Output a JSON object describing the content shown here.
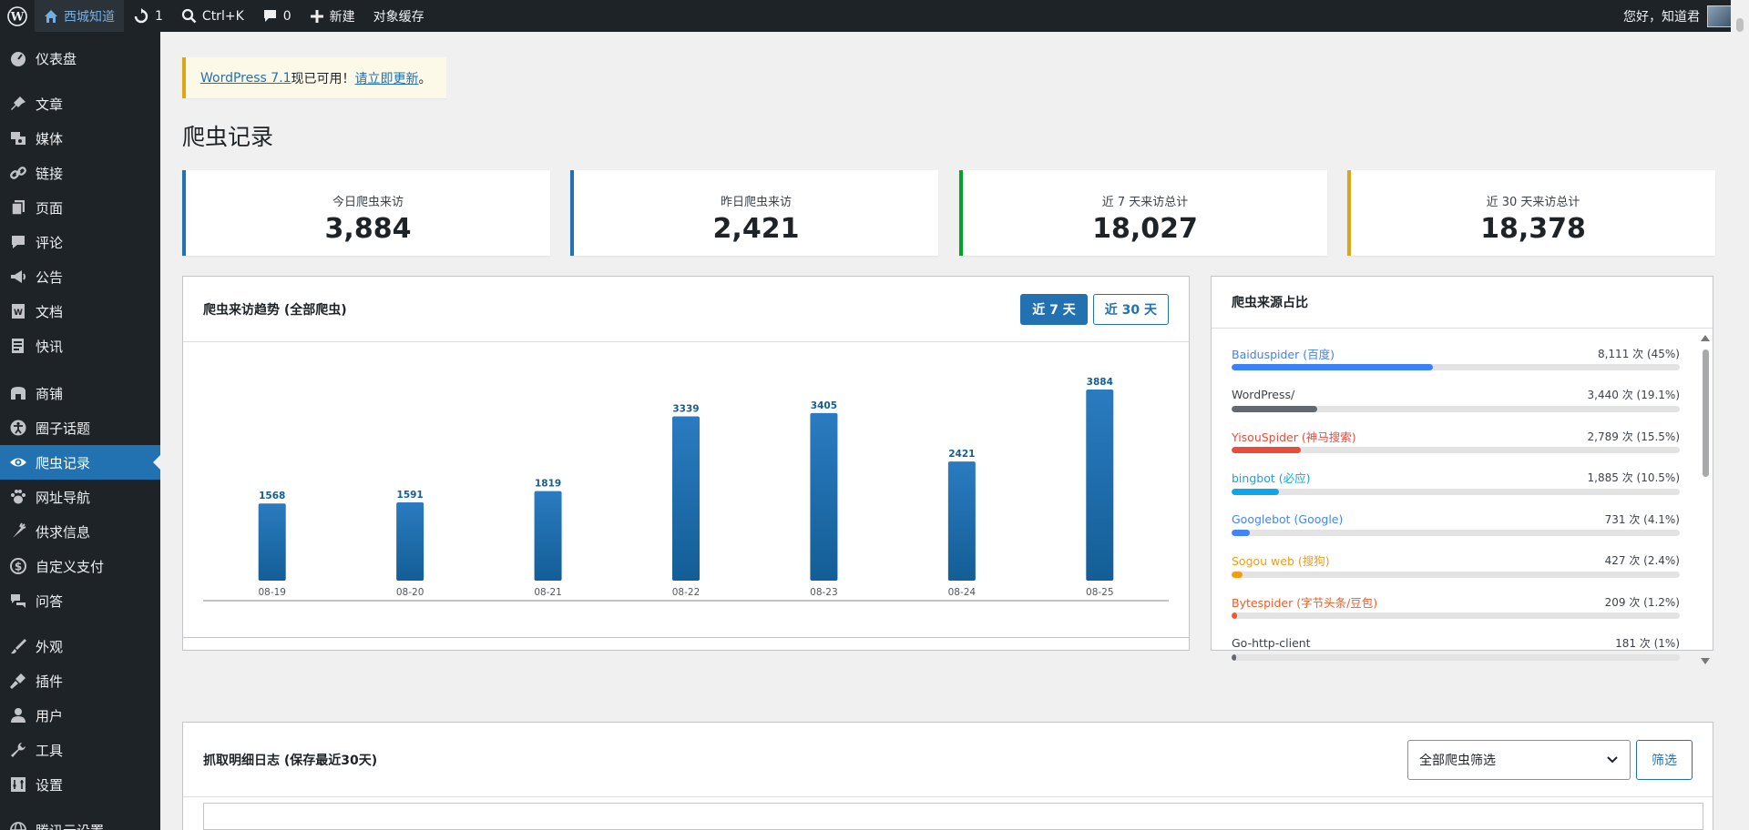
{
  "admin_bar": {
    "site_name": "西城知道",
    "updates_count": "1",
    "search_shortcut": "Ctrl+K",
    "comments_count": "0",
    "new_label": "新建",
    "object_cache_label": "对象缓存",
    "greeting": "您好，知道君"
  },
  "sidebar": {
    "items": [
      {
        "label": "仪表盘",
        "icon": "dashboard-icon"
      },
      {
        "label": "文章",
        "icon": "pin-icon"
      },
      {
        "label": "媒体",
        "icon": "media-icon"
      },
      {
        "label": "链接",
        "icon": "link-icon"
      },
      {
        "label": "页面",
        "icon": "page-icon"
      },
      {
        "label": "评论",
        "icon": "comment-icon"
      },
      {
        "label": "公告",
        "icon": "megaphone-icon"
      },
      {
        "label": "文档",
        "icon": "document-icon"
      },
      {
        "label": "快讯",
        "icon": "news-icon"
      },
      {
        "label": "商铺",
        "icon": "shop-icon"
      },
      {
        "label": "圈子话题",
        "icon": "accessibility-icon"
      },
      {
        "label": "爬虫记录",
        "icon": "eye-icon"
      },
      {
        "label": "网址导航",
        "icon": "paw-icon"
      },
      {
        "label": "供求信息",
        "icon": "carrot-icon"
      },
      {
        "label": "自定义支付",
        "icon": "dollar-icon"
      },
      {
        "label": "问答",
        "icon": "chat-icon"
      },
      {
        "label": "外观",
        "icon": "brush-icon"
      },
      {
        "label": "插件",
        "icon": "plugin-icon"
      },
      {
        "label": "用户",
        "icon": "user-icon"
      },
      {
        "label": "工具",
        "icon": "wrench-icon"
      },
      {
        "label": "设置",
        "icon": "settings-icon"
      },
      {
        "label": "腾讯云设置",
        "icon": "globe-icon"
      }
    ]
  },
  "notice": {
    "link_text": "WordPress 7.1",
    "middle_text": " 现已可用！",
    "action_text": "请立即更新",
    "end_text": "。"
  },
  "page_title": "爬虫记录",
  "stats": [
    {
      "label": "今日爬虫来访",
      "value": "3,884",
      "color": "#2271b1"
    },
    {
      "label": "昨日爬虫来访",
      "value": "2,421",
      "color": "#2271b1"
    },
    {
      "label": "近 7 天来访总计",
      "value": "18,027",
      "color": "#00a32a"
    },
    {
      "label": "近 30 天来访总计",
      "value": "18,378",
      "color": "#dba617"
    }
  ],
  "trend": {
    "title": "爬虫来访趋势 (全部爬虫)",
    "btn_7": "近 7 天",
    "btn_30": "近 30 天"
  },
  "chart_data": {
    "type": "bar",
    "categories": [
      "08-19",
      "08-20",
      "08-21",
      "08-22",
      "08-23",
      "08-24",
      "08-25"
    ],
    "values": [
      1568,
      1591,
      1819,
      3339,
      3405,
      2421,
      3884
    ],
    "title": "",
    "xlabel": "",
    "ylabel": "",
    "ylim": [
      0,
      3884
    ],
    "color": "#2271b1",
    "grid": false
  },
  "sources": {
    "title": "爬虫来源占比",
    "items": [
      {
        "name": "Baiduspider (百度)",
        "count": "8,111 次 (45%)",
        "pct": 45,
        "color": "#3b82f6"
      },
      {
        "name": "WordPress/",
        "count": "3,440 次 (19.1%)",
        "pct": 19.1,
        "color": "#646970"
      },
      {
        "name": "YisouSpider (神马搜索)",
        "count": "2,789 次 (15.5%)",
        "pct": 15.5,
        "color": "#e74c3c"
      },
      {
        "name": "bingbot (必应)",
        "count": "1,885 次 (10.5%)",
        "pct": 10.5,
        "color": "#0ea5e9"
      },
      {
        "name": "Googlebot (Google)",
        "count": "731 次 (4.1%)",
        "pct": 4.1,
        "color": "#4285f4"
      },
      {
        "name": "Sogou web (搜狗)",
        "count": "427 次 (2.4%)",
        "pct": 2.4,
        "color": "#f39c12"
      },
      {
        "name": "Bytespider (字节头条/豆包)",
        "count": "209 次 (1.2%)",
        "pct": 1.2,
        "color": "#f05a28"
      },
      {
        "name": "Go-http-client",
        "count": "181 次 (1%)",
        "pct": 1,
        "color": "#646970"
      }
    ]
  },
  "log": {
    "title": "抓取明细日志 (保存最近30天)",
    "filter_select": "全部爬虫筛选",
    "filter_button": "筛选"
  }
}
